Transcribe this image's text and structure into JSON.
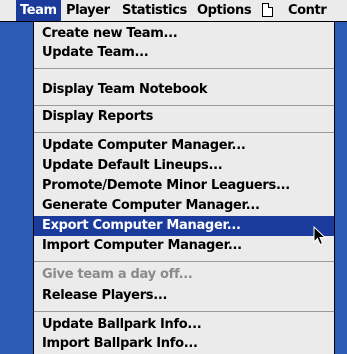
{
  "menubar": {
    "items": [
      {
        "label": "Team",
        "active": true
      },
      {
        "label": "Player"
      },
      {
        "label": "Statistics"
      },
      {
        "label": "Options"
      },
      {
        "label": "Contr"
      }
    ],
    "window_icon": "document-icon"
  },
  "menu": {
    "items": [
      {
        "label": "Create new Team..."
      },
      {
        "label": "Update Team..."
      },
      {
        "label": "Display Team Notebook"
      },
      {
        "label": "Display Reports"
      },
      {
        "label": "Update Computer Manager..."
      },
      {
        "label": "Update Default Lineups..."
      },
      {
        "label": "Promote/Demote Minor Leaguers..."
      },
      {
        "label": "Generate Computer Manager..."
      },
      {
        "label": "Export Computer Manager...",
        "selected": true
      },
      {
        "label": "Import Computer Manager..."
      },
      {
        "label": "Give team a day off...",
        "disabled": true
      },
      {
        "label": "Release Players..."
      },
      {
        "label": "Update Ballpark Info..."
      },
      {
        "label": "Import Ballpark Info..."
      }
    ]
  },
  "colors": {
    "background": "#2b5cb5",
    "highlight": "#1a3a9c",
    "menu_bg": "#ebebeb"
  }
}
